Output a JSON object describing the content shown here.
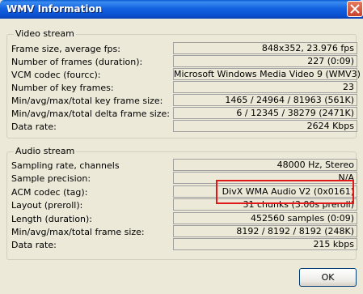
{
  "window": {
    "title": "WMV Information"
  },
  "video": {
    "group_label": "Video stream",
    "rows": [
      {
        "label": "Frame size, average fps:",
        "value": "848x352, 23.976 fps"
      },
      {
        "label": "Number of frames (duration):",
        "value": "227 (0:09)"
      },
      {
        "label": "VCM codec (fourcc):",
        "value": "Microsoft Windows Media Video 9 (WMV3)"
      },
      {
        "label": "Number of key frames:",
        "value": "23"
      },
      {
        "label": "Min/avg/max/total key frame size:",
        "value": "1465 / 24964 / 81963 (561K)"
      },
      {
        "label": "Min/avg/max/total delta frame size:",
        "value": "6 / 12345 / 38279 (2471K)"
      },
      {
        "label": "Data rate:",
        "value": "2624 Kbps"
      }
    ]
  },
  "audio": {
    "group_label": "Audio stream",
    "rows": [
      {
        "label": "Sampling rate, channels",
        "value": "48000 Hz, Stereo"
      },
      {
        "label": "Sample precision:",
        "value": "N/A"
      },
      {
        "label": "ACM codec (tag):",
        "value": "DivX WMA Audio V2 (0x0161)"
      },
      {
        "label": "Layout (preroll):",
        "value": "31 chunks (3.00s preroll)"
      },
      {
        "label": "Length (duration):",
        "value": "452560 samples (0:09)"
      },
      {
        "label": "Min/avg/max/total frame size:",
        "value": "8192 / 8192 / 8192 (248K)"
      },
      {
        "label": "Data rate:",
        "value": "215 kbps"
      }
    ]
  },
  "buttons": {
    "ok": "OK"
  },
  "icons": {
    "close": "close-icon"
  },
  "colors": {
    "title_bar": "#0a5bd3",
    "highlight": "#e01818",
    "background": "#ece9d8"
  }
}
